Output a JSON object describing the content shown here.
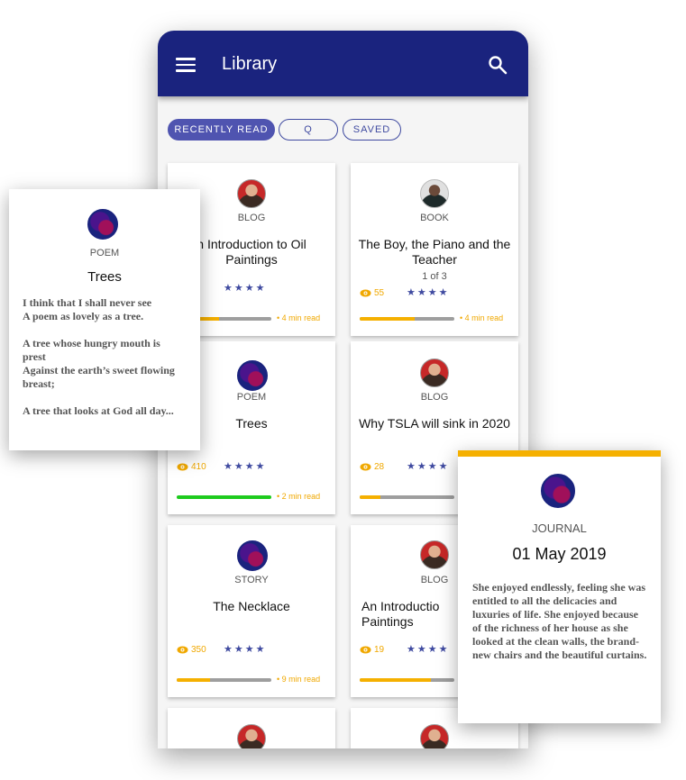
{
  "app": {
    "title": "Library",
    "menu_icon": "menu-icon",
    "search_icon": "search-icon"
  },
  "chips": [
    {
      "label": "RECENTLY READ",
      "active": true
    },
    {
      "label": "Q",
      "active": false
    },
    {
      "label": "SAVED",
      "active": false
    }
  ],
  "cards": [
    {
      "type": "BLOG",
      "title": "n Introduction to Oil Paintings",
      "subtitle": "",
      "views": "",
      "rating": "★★★★",
      "progress": 0.45,
      "progress_color": "#f5b000",
      "read_time": "• 4 min read"
    },
    {
      "type": "BOOK",
      "title": "The Boy, the Piano and the Teacher",
      "subtitle": "1 of 3",
      "views": "55",
      "rating": "★★★★",
      "progress": 0.58,
      "progress_color": "#f5b000",
      "read_time": "• 4 min read"
    },
    {
      "type": "POEM",
      "title": "Trees",
      "subtitle": "",
      "views": "410",
      "rating": "★★★★",
      "progress": 1.0,
      "progress_color": "#1ecb1e",
      "read_time": "• 2 min read"
    },
    {
      "type": "BLOG",
      "title": "Why TSLA will sink in 2020",
      "subtitle": "",
      "views": "28",
      "rating": "★★★★",
      "progress": 0.22,
      "progress_color": "#f5b000",
      "read_time": ""
    },
    {
      "type": "STORY",
      "title": "The Necklace",
      "subtitle": "",
      "views": "350",
      "rating": "★★★★",
      "progress": 0.35,
      "progress_color": "#f5b000",
      "read_time": "• 9 min read"
    },
    {
      "type": "BLOG",
      "title": "An Introductio Paintings",
      "subtitle": "",
      "views": "19",
      "rating": "★★★★",
      "progress": 0.75,
      "progress_color": "#f5b000",
      "read_time": ""
    }
  ],
  "overlay_poem": {
    "type": "POEM",
    "title": "Trees",
    "text": "I think that I shall never see\nA poem as lovely as a tree.\n\nA tree whose hungry mouth is prest\nAgainst the earth’s sweet flowing breast;\n\nA tree that looks at God all day..."
  },
  "overlay_journal": {
    "type": "JOURNAL",
    "title": "01 May 2019",
    "text": "She enjoyed endlessly, feeling she was entitled to all the delicacies and luxuries of life. She enjoyed because of the richness of her house as she looked at the clean walls, the brand-new chairs and the beautiful curtains."
  },
  "colors": {
    "appbar": "#1a237e",
    "accent": "#3f4aa0",
    "progress": "#f5b000",
    "complete": "#1ecb1e"
  }
}
